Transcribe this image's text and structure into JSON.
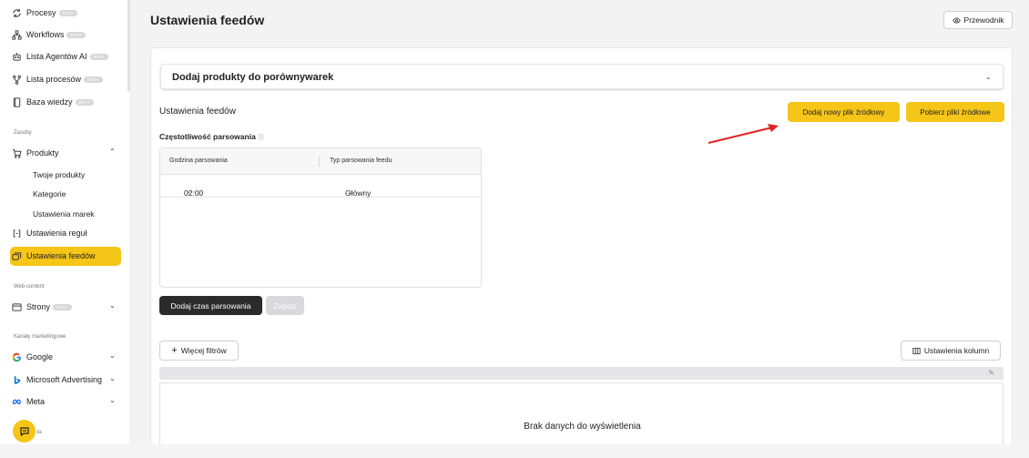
{
  "sidebar": {
    "items": [
      {
        "label": "Procesy",
        "badge": "BETA",
        "icon": "sync-icon"
      },
      {
        "label": "Workflows",
        "badge": "BETA",
        "icon": "flow-icon"
      },
      {
        "label": "Lista Agentów AI",
        "badge": "BETA",
        "icon": "robot-icon"
      },
      {
        "label": "Lista procesów",
        "badge": "BETA",
        "icon": "branch-icon"
      },
      {
        "label": "Baza wiedzy",
        "badge": "BETA",
        "icon": "book-icon"
      }
    ],
    "section_resources": "Zasoby",
    "products_label": "Produkty",
    "products_sub": [
      "Twoje produkty",
      "Kategorie",
      "Ustawienia marek"
    ],
    "rules_label": "Ustawienia reguł",
    "feeds_label": "Ustawienia feedów",
    "section_web": "Web content",
    "pages_label": "Strony",
    "pages_badge": "BETA",
    "section_channels": "Kanały marketingowe",
    "google_label": "Google",
    "microsoft_label": "Microsoft Advertising",
    "meta_label": "Meta",
    "peek_text": "ła"
  },
  "header": {
    "title": "Ustawienia feedów",
    "guide_label": "Przewodnik"
  },
  "accordion": {
    "title": "Dodaj produkty do porównywarek"
  },
  "feeds": {
    "section_title": "Ustawienia feedów",
    "add_source_label": "Dodaj nowy plik źródłowy",
    "download_sources_label": "Pobierz pliki źródłowe",
    "frequency_label": "Częstotliwość parsowania",
    "table": {
      "columns": [
        "Godzina parsowania",
        "Typ parsowania feedu"
      ],
      "rows": [
        {
          "time": "02:00",
          "type": "Główny"
        }
      ]
    },
    "add_time_label": "Dodaj czas parsowania",
    "save_label": "Zapisz"
  },
  "grid": {
    "more_filters_label": "Więcej filtrów",
    "columns_settings_label": "Ustawienia kolumn",
    "empty_text": "Brak danych do wyświetlenia"
  },
  "colors": {
    "accent": "#f5c518",
    "dark": "#2b2b2b",
    "arrow": "#e02424"
  }
}
